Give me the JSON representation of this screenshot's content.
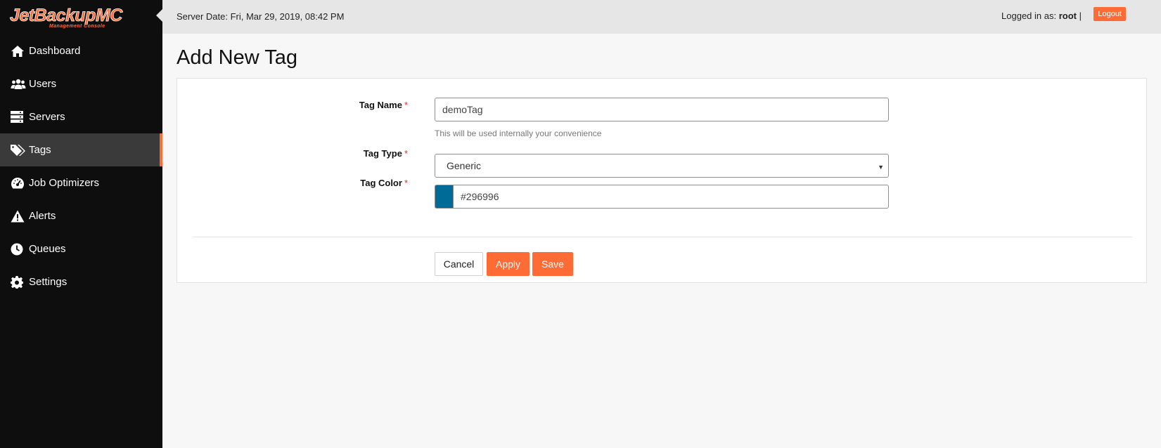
{
  "app": {
    "logo_text": "JetBackupMC",
    "logo_subtitle": "Management Console",
    "brand_color": "#ff6b35"
  },
  "header": {
    "server_date": "Server Date: Fri, Mar 29, 2019, 08:42 PM",
    "logged_in_prefix": "Logged in as: ",
    "username": "root",
    "separator": " |",
    "logout_label": "Logout"
  },
  "sidebar": {
    "items": [
      {
        "label": "Dashboard",
        "icon": "home-icon",
        "active": false
      },
      {
        "label": "Users",
        "icon": "users-icon",
        "active": false
      },
      {
        "label": "Servers",
        "icon": "servers-icon",
        "active": false
      },
      {
        "label": "Tags",
        "icon": "tags-icon",
        "active": true
      },
      {
        "label": "Job Optimizers",
        "icon": "gauge-icon",
        "active": false
      },
      {
        "label": "Alerts",
        "icon": "warning-icon",
        "active": false
      },
      {
        "label": "Queues",
        "icon": "clock-icon",
        "active": false
      },
      {
        "label": "Settings",
        "icon": "gear-icon",
        "active": false
      }
    ]
  },
  "page": {
    "title": "Add New Tag"
  },
  "form": {
    "tag_name": {
      "label": "Tag Name",
      "required_mark": "*",
      "value": "demoTag",
      "help": "This will be used internally your convenience"
    },
    "tag_type": {
      "label": "Tag Type",
      "required_mark": "*",
      "selected": "Generic"
    },
    "tag_color": {
      "label": "Tag Color",
      "required_mark": "*",
      "value": "#296996",
      "swatch_color": "#006b96"
    },
    "buttons": {
      "cancel": "Cancel",
      "apply": "Apply",
      "save": "Save"
    }
  }
}
